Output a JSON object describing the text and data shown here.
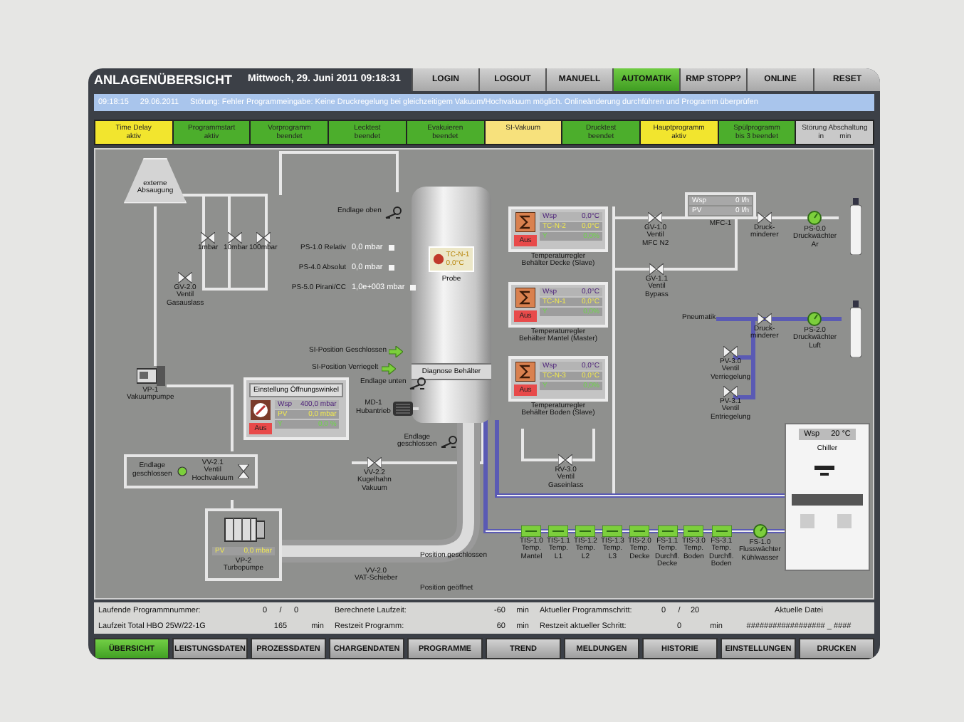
{
  "header": {
    "title": "ANLAGENÜBERSICHT",
    "datetime": "Mittwoch, 29. Juni 2011 09:18:31",
    "buttons": [
      {
        "label": "LOGIN",
        "selected": false
      },
      {
        "label": "LOGOUT",
        "selected": false
      },
      {
        "label": "MANUELL",
        "selected": false
      },
      {
        "label": "AUTOMATIK",
        "selected": true
      },
      {
        "label": "RMP STOPP?",
        "selected": false
      },
      {
        "label": "ONLINE",
        "selected": false
      },
      {
        "label": "RESET",
        "selected": false
      }
    ]
  },
  "message": {
    "time": "09:18:15",
    "date": "29.06.2011",
    "text": "Störung: Fehler Programmeingabe: Keine Druckregelung bei gleichzeitigem Vakuum/Hochvakuum möglich. Onlineänderung durchführen und Programm überprüfen"
  },
  "steps": [
    {
      "label": "Time Delay",
      "sub": "aktiv",
      "color": "#f2e52e"
    },
    {
      "label": "Programmstart",
      "sub": "aktiv",
      "color": "#4cae2c"
    },
    {
      "label": "Vorprogramm",
      "sub": "beendet",
      "color": "#4cae2c"
    },
    {
      "label": "Lecktest",
      "sub": "beendet",
      "color": "#4cae2c"
    },
    {
      "label": "Evakuieren",
      "sub": "beendet",
      "color": "#4cae2c"
    },
    {
      "label": "SI-Vakuum",
      "color": "#f7e17c"
    },
    {
      "label": "Drucktest",
      "sub": "beendet",
      "color": "#4cae2c"
    },
    {
      "label": "Hauptprogramm",
      "sub": "aktiv",
      "color": "#f2e52e"
    },
    {
      "label": "Spülprogramm",
      "sub": "bis 3 beendet",
      "color": "#4cae2c"
    },
    {
      "label": "Störung Abschaltung",
      "sub": "in        min",
      "color": "#c9c9c9"
    }
  ],
  "diagram": {
    "items": [
      {
        "kind": "hood",
        "lines": [
          "externe",
          "Absaugung"
        ]
      },
      {
        "kind": "valve",
        "lines": [
          "1mbar"
        ]
      },
      {
        "kind": "valve",
        "lines": [
          "10mbar"
        ]
      },
      {
        "kind": "valve",
        "lines": [
          "100mbar"
        ]
      },
      {
        "kind": "valve",
        "lines": [
          "GV-2.0",
          "Ventil",
          "Gasauslass"
        ]
      },
      {
        "kind": "pump",
        "lines": [
          "VP-1",
          "Vakuumpumpe"
        ]
      },
      {
        "kind": "tank",
        "tag": "TC-N-1",
        "value": "0,0°C",
        "label": "Probe",
        "caption": "Diagnose Behälter"
      },
      {
        "kind": "limit",
        "lines": [
          "Endlage oben"
        ]
      },
      {
        "kind": "reading",
        "label": "PS-1.0 Relativ",
        "value": "0,0 mbar"
      },
      {
        "kind": "reading",
        "label": "PS-4.0 Absolut",
        "value": "0,0 mbar"
      },
      {
        "kind": "reading",
        "label": "PS-5.0 Pirani/CC",
        "value": "1,0e+003 mbar"
      },
      {
        "kind": "signal",
        "lines": [
          "SI-Position Geschlossen"
        ]
      },
      {
        "kind": "signal",
        "lines": [
          "SI-Position Verriegelt"
        ]
      },
      {
        "kind": "limit",
        "lines": [
          "Endlage unten"
        ]
      },
      {
        "kind": "setpoint-panel",
        "title": "Einstellung Öffnungswinkel",
        "switch": "Aus",
        "rows": [
          {
            "kind": "setpoint",
            "label": "Wsp",
            "value": "400,0 mbar"
          },
          {
            "kind": "process",
            "label": "PV",
            "value": "0,0 mbar"
          },
          {
            "kind": "output",
            "label": "Y",
            "value": "0,0 %"
          }
        ]
      },
      {
        "kind": "motor",
        "lines": [
          "MD-1",
          "Hubantrieb"
        ]
      },
      {
        "kind": "valve-box",
        "limit": [
          "Endlage",
          "geschlossen"
        ],
        "lines": [
          "VV-2.1",
          "Ventil",
          "Hochvakuum"
        ]
      },
      {
        "kind": "valve",
        "lines": [
          "VV-2.2",
          "Kugelhahn",
          "Vakuum"
        ]
      },
      {
        "kind": "limit",
        "lines": [
          "Endlage",
          "geschlossen"
        ]
      },
      {
        "kind": "turbo",
        "rows": [
          {
            "kind": "process",
            "label": "PV",
            "value": "0,0 mbar"
          }
        ],
        "lines": [
          "VP-2",
          "Turbopumpe"
        ]
      },
      {
        "kind": "text",
        "lines": [
          "VV-2.0",
          "VAT-Schieber"
        ]
      },
      {
        "kind": "text",
        "lines": [
          "Position geschlossen"
        ]
      },
      {
        "kind": "text",
        "lines": [
          "Position geöffnet"
        ]
      },
      {
        "kind": "temp-controller",
        "switch": "Aus",
        "rows": [
          {
            "kind": "setpoint",
            "label": "Wsp",
            "value": "0,0°C"
          },
          {
            "kind": "process",
            "label": "TC-N-2",
            "value": "0,0°C"
          },
          {
            "kind": "output",
            "label": "Y",
            "value": "0,0%"
          }
        ],
        "lines": [
          "Temperaturregler",
          "Behälter Decke (Slave)"
        ]
      },
      {
        "kind": "temp-controller",
        "switch": "Aus",
        "rows": [
          {
            "kind": "setpoint",
            "label": "Wsp",
            "value": "0,0°C"
          },
          {
            "kind": "process",
            "label": "TC-N-1",
            "value": "0,0°C"
          },
          {
            "kind": "output",
            "label": "Y",
            "value": "0,0%"
          }
        ],
        "lines": [
          "Temperaturregler",
          "Behälter Mantel (Master)"
        ]
      },
      {
        "kind": "temp-controller",
        "switch": "Aus",
        "rows": [
          {
            "kind": "setpoint",
            "label": "Wsp",
            "value": "0,0°C"
          },
          {
            "kind": "process",
            "label": "TC-N-3",
            "value": "0,0°C"
          },
          {
            "kind": "output",
            "label": "Y",
            "value": "0,0%"
          }
        ],
        "lines": [
          "Temperaturregler",
          "Behälter Boden (Slave)"
        ]
      },
      {
        "kind": "valve",
        "lines": [
          "GV-1.0",
          "Ventil",
          "MFC N2"
        ]
      },
      {
        "kind": "mfc",
        "rows": [
          {
            "kind": "plain",
            "label": "Wsp",
            "value": "0 l/h"
          },
          {
            "kind": "plain",
            "label": "PV",
            "value": "0 l/h"
          }
        ],
        "lines": [
          "MFC-1"
        ]
      },
      {
        "kind": "valve",
        "lines": [
          "GV-1.1",
          "Ventil",
          "Bypass"
        ]
      },
      {
        "kind": "valve",
        "lines": [
          "Druck-",
          "minderer"
        ]
      },
      {
        "kind": "gauge",
        "lines": [
          "PS-0.0",
          "Druckwächter",
          "Ar"
        ]
      },
      {
        "kind": "bottle"
      },
      {
        "kind": "text",
        "lines": [
          "Pneumatik"
        ]
      },
      {
        "kind": "valve",
        "lines": [
          "Druck-",
          "minderer"
        ]
      },
      {
        "kind": "gauge",
        "lines": [
          "PS-2.0",
          "Druckwächter",
          "Luft"
        ]
      },
      {
        "kind": "bottle"
      },
      {
        "kind": "valve",
        "lines": [
          "PV-3.0",
          "Ventil",
          "Verriegelung"
        ]
      },
      {
        "kind": "valve",
        "lines": [
          "PV-3.1",
          "Ventil",
          "Entriegelung"
        ]
      },
      {
        "kind": "valve",
        "lines": [
          "RV-3.0",
          "Ventil",
          "Gaseinlass"
        ]
      },
      {
        "kind": "chiller",
        "tag": "Wsp",
        "value": "20 °C",
        "label": "Chiller"
      },
      {
        "kind": "sensor",
        "lines": [
          "TIS-1.0",
          "Temp.",
          "Mantel"
        ]
      },
      {
        "kind": "sensor",
        "lines": [
          "TIS-1.1",
          "Temp.",
          "L1"
        ]
      },
      {
        "kind": "sensor",
        "lines": [
          "TIS-1.2",
          "Temp.",
          "L2"
        ]
      },
      {
        "kind": "sensor",
        "lines": [
          "TIS-1.3",
          "Temp.",
          "L3"
        ]
      },
      {
        "kind": "sensor",
        "lines": [
          "TIS-2.0",
          "Temp.",
          "Decke"
        ]
      },
      {
        "kind": "sensor",
        "lines": [
          "FS-1.1",
          "Temp.",
          "Durchfl.",
          "Decke"
        ]
      },
      {
        "kind": "sensor",
        "lines": [
          "TIS-3.0",
          "Temp.",
          "Boden"
        ]
      },
      {
        "kind": "sensor",
        "lines": [
          "FS-3.1",
          "Temp.",
          "Durchfl.",
          "Boden"
        ]
      },
      {
        "kind": "gauge",
        "lines": [
          "FS-1.0",
          "Flusswächter",
          "Kühlwasser"
        ]
      }
    ]
  },
  "info": [
    [
      {
        "kind": "label",
        "text": "Laufende Programmnummer:"
      },
      {
        "kind": "num",
        "text": "0"
      },
      {
        "kind": "sep",
        "text": "/"
      },
      {
        "kind": "num",
        "text": "0"
      },
      {
        "kind": "gap"
      },
      {
        "kind": "label2",
        "text": "Berechnete Laufzeit:"
      },
      {
        "kind": "value",
        "text": "-60"
      },
      {
        "kind": "unit",
        "text": "min"
      },
      {
        "kind": "label2",
        "text": "Aktueller Programmschritt:"
      },
      {
        "kind": "num",
        "text": "0"
      },
      {
        "kind": "sep",
        "text": "/"
      },
      {
        "kind": "num",
        "text": "20"
      },
      {
        "kind": "gap"
      },
      {
        "kind": "file",
        "text": "Aktuelle Datei"
      }
    ],
    [
      {
        "kind": "label",
        "text": "Laufzeit Total HBO 25W/22-1G"
      },
      {
        "kind": "wide",
        "text": "165"
      },
      {
        "kind": "unit",
        "text": "min"
      },
      {
        "kind": "label2",
        "text": "Restzeit Programm:"
      },
      {
        "kind": "value",
        "text": "60"
      },
      {
        "kind": "unit",
        "text": "min"
      },
      {
        "kind": "label2",
        "text": "Restzeit aktueller Schritt:"
      },
      {
        "kind": "wide",
        "text": "0"
      },
      {
        "kind": "unit",
        "text": "min"
      },
      {
        "kind": "file",
        "text": "################## _ ####"
      }
    ]
  ],
  "nav": [
    {
      "label": "ÜBERSICHT",
      "selected": true
    },
    {
      "label": "LEISTUNGSDATEN",
      "selected": false
    },
    {
      "label": "PROZESSDATEN",
      "selected": false
    },
    {
      "label": "CHARGENDATEN",
      "selected": false
    },
    {
      "label": "PROGRAMME",
      "selected": false
    },
    {
      "label": "TREND",
      "selected": false
    },
    {
      "label": "MELDUNGEN",
      "selected": false
    },
    {
      "label": "HISTORIE",
      "selected": false
    },
    {
      "label": "EINSTELLUNGEN",
      "selected": false
    },
    {
      "label": "DRUCKEN",
      "selected": false
    }
  ]
}
